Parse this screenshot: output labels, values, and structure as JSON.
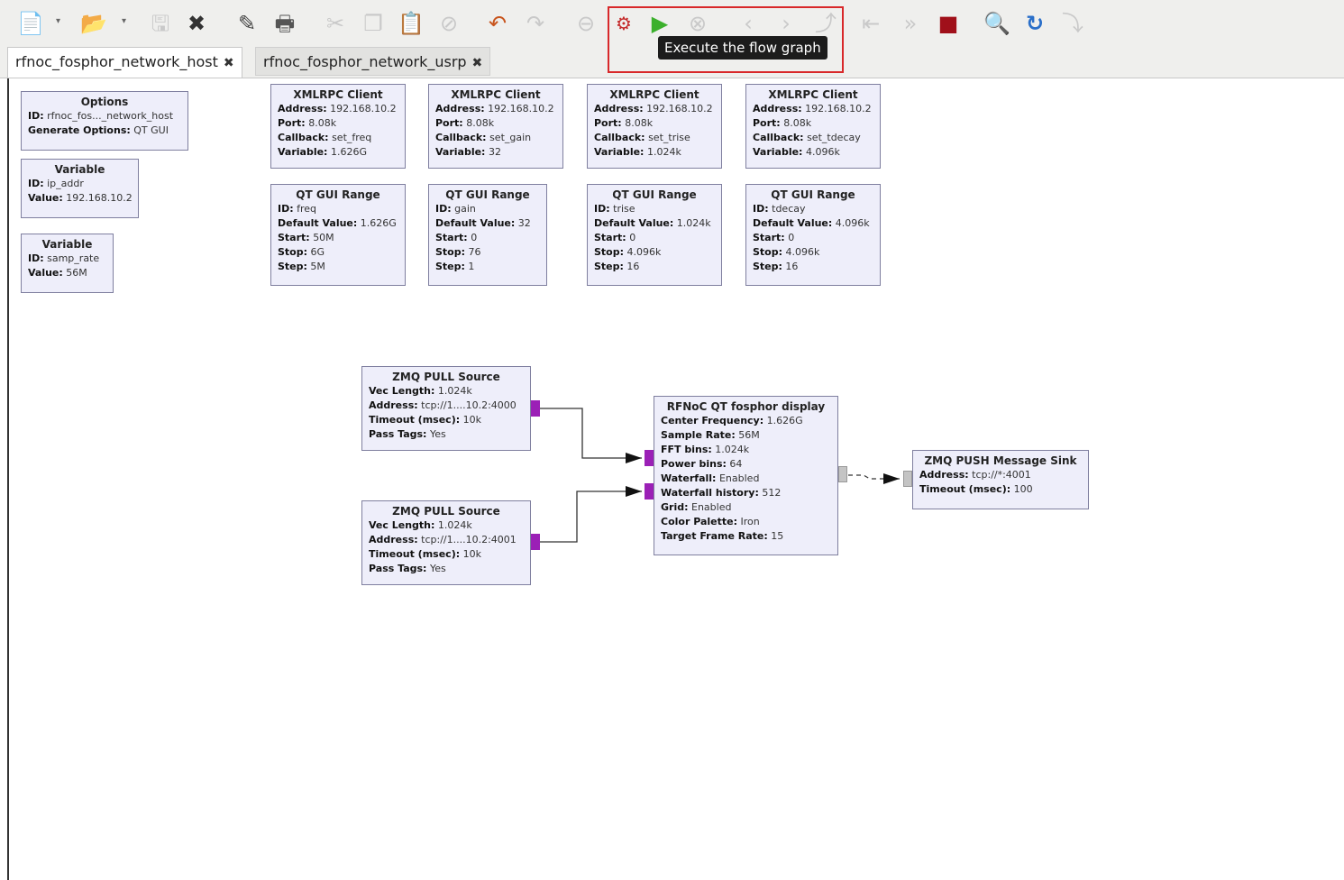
{
  "tooltip": "Execute the flow graph",
  "toolbar": {
    "icons": [
      "new-icon",
      "open-icon",
      "save-icon",
      "close-icon",
      "edit-icon",
      "print-icon",
      "cut-icon",
      "copy-icon",
      "paste-icon",
      "cancel-icon",
      "undo-icon",
      "redo-icon",
      "disable-icon",
      "generate-icon",
      "execute-icon",
      "kill-icon",
      "rotate-left-icon",
      "rotate-right-icon",
      "enable-icon",
      "bypass-icon",
      "search-icon",
      "reload-icon"
    ]
  },
  "tabs": [
    {
      "label": "rfnoc_fosphor_network_host",
      "close": "✖",
      "active": true
    },
    {
      "label": "rfnoc_fosphor_network_usrp",
      "close": "✖",
      "active": false
    }
  ],
  "blocks": {
    "options": {
      "title": "Options",
      "rows": [
        {
          "k": "ID:",
          "v": "rfnoc_fos..._network_host"
        },
        {
          "k": "Generate Options:",
          "v": "QT GUI"
        }
      ]
    },
    "var_ip": {
      "title": "Variable",
      "rows": [
        {
          "k": "ID:",
          "v": "ip_addr"
        },
        {
          "k": "Value:",
          "v": "192.168.10.2"
        }
      ]
    },
    "var_samp": {
      "title": "Variable",
      "rows": [
        {
          "k": "ID:",
          "v": "samp_rate"
        },
        {
          "k": "Value:",
          "v": "56M"
        }
      ]
    },
    "xml1": {
      "title": "XMLRPC Client",
      "rows": [
        {
          "k": "Address:",
          "v": "192.168.10.2"
        },
        {
          "k": "Port:",
          "v": "8.08k"
        },
        {
          "k": "Callback:",
          "v": "set_freq"
        },
        {
          "k": "Variable:",
          "v": "1.626G"
        }
      ]
    },
    "xml2": {
      "title": "XMLRPC Client",
      "rows": [
        {
          "k": "Address:",
          "v": "192.168.10.2"
        },
        {
          "k": "Port:",
          "v": "8.08k"
        },
        {
          "k": "Callback:",
          "v": "set_gain"
        },
        {
          "k": "Variable:",
          "v": "32"
        }
      ]
    },
    "xml3": {
      "title": "XMLRPC Client",
      "rows": [
        {
          "k": "Address:",
          "v": "192.168.10.2"
        },
        {
          "k": "Port:",
          "v": "8.08k"
        },
        {
          "k": "Callback:",
          "v": "set_trise"
        },
        {
          "k": "Variable:",
          "v": "1.024k"
        }
      ]
    },
    "xml4": {
      "title": "XMLRPC Client",
      "rows": [
        {
          "k": "Address:",
          "v": "192.168.10.2"
        },
        {
          "k": "Port:",
          "v": "8.08k"
        },
        {
          "k": "Callback:",
          "v": "set_tdecay"
        },
        {
          "k": "Variable:",
          "v": "4.096k"
        }
      ]
    },
    "rng1": {
      "title": "QT GUI Range",
      "rows": [
        {
          "k": "ID:",
          "v": "freq"
        },
        {
          "k": "Default Value:",
          "v": "1.626G"
        },
        {
          "k": "Start:",
          "v": "50M"
        },
        {
          "k": "Stop:",
          "v": "6G"
        },
        {
          "k": "Step:",
          "v": "5M"
        }
      ]
    },
    "rng2": {
      "title": "QT GUI Range",
      "rows": [
        {
          "k": "ID:",
          "v": "gain"
        },
        {
          "k": "Default Value:",
          "v": "32"
        },
        {
          "k": "Start:",
          "v": "0"
        },
        {
          "k": "Stop:",
          "v": "76"
        },
        {
          "k": "Step:",
          "v": "1"
        }
      ]
    },
    "rng3": {
      "title": "QT GUI Range",
      "rows": [
        {
          "k": "ID:",
          "v": "trise"
        },
        {
          "k": "Default Value:",
          "v": "1.024k"
        },
        {
          "k": "Start:",
          "v": "0"
        },
        {
          "k": "Stop:",
          "v": "4.096k"
        },
        {
          "k": "Step:",
          "v": "16"
        }
      ]
    },
    "rng4": {
      "title": "QT GUI Range",
      "rows": [
        {
          "k": "ID:",
          "v": "tdecay"
        },
        {
          "k": "Default Value:",
          "v": "4.096k"
        },
        {
          "k": "Start:",
          "v": "0"
        },
        {
          "k": "Stop:",
          "v": "4.096k"
        },
        {
          "k": "Step:",
          "v": "16"
        }
      ]
    },
    "zmq1": {
      "title": "ZMQ PULL Source",
      "rows": [
        {
          "k": "Vec Length:",
          "v": "1.024k"
        },
        {
          "k": "Address:",
          "v": "tcp://1....10.2:4000"
        },
        {
          "k": "Timeout (msec):",
          "v": "10k"
        },
        {
          "k": "Pass Tags:",
          "v": "Yes"
        }
      ]
    },
    "zmq2": {
      "title": "ZMQ PULL Source",
      "rows": [
        {
          "k": "Vec Length:",
          "v": "1.024k"
        },
        {
          "k": "Address:",
          "v": "tcp://1....10.2:4001"
        },
        {
          "k": "Timeout (msec):",
          "v": "10k"
        },
        {
          "k": "Pass Tags:",
          "v": "Yes"
        }
      ]
    },
    "fosphor": {
      "title": "RFNoC QT fosphor display",
      "rows": [
        {
          "k": "Center Frequency:",
          "v": "1.626G"
        },
        {
          "k": "Sample Rate:",
          "v": "56M"
        },
        {
          "k": "FFT bins:",
          "v": "1.024k"
        },
        {
          "k": "Power bins:",
          "v": "64"
        },
        {
          "k": "Waterfall:",
          "v": "Enabled"
        },
        {
          "k": "Waterfall history:",
          "v": "512"
        },
        {
          "k": "Grid:",
          "v": "Enabled"
        },
        {
          "k": "Color Palette:",
          "v": "Iron"
        },
        {
          "k": "Target Frame Rate:",
          "v": "15"
        }
      ]
    },
    "sink": {
      "title": "ZMQ PUSH Message Sink",
      "rows": [
        {
          "k": "Address:",
          "v": "tcp://*:4001"
        },
        {
          "k": "Timeout (msec):",
          "v": "100"
        }
      ]
    }
  }
}
